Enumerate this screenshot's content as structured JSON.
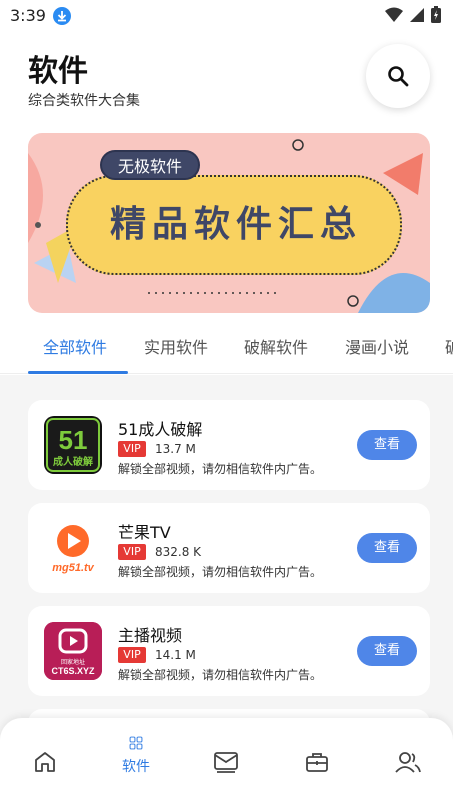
{
  "status_bar": {
    "time": "3:39"
  },
  "header": {
    "title": "软件",
    "subtitle": "综合类软件大合集"
  },
  "banner": {
    "tag": "无极软件",
    "title": "精品软件汇总"
  },
  "tabs": [
    {
      "label": "全部软件"
    },
    {
      "label": "实用软件"
    },
    {
      "label": "破解软件"
    },
    {
      "label": "漫画小说"
    },
    {
      "label": "破"
    }
  ],
  "apps": [
    {
      "name": "51成人破解",
      "badge": "VIP",
      "size": "13.7 M",
      "desc": "解锁全部视频，请勿相信软件内广告。",
      "button": "查看",
      "icon": "app-51-icon"
    },
    {
      "name": "芒果TV",
      "badge": "VIP",
      "size": "832.8 K",
      "desc": "解锁全部视频，请勿相信软件内广告。",
      "button": "查看",
      "icon": "mango-tv-icon"
    },
    {
      "name": "主播视频",
      "badge": "VIP",
      "size": "14.1 M",
      "desc": "解锁全部视频，请勿相信软件内广告。",
      "button": "查看",
      "icon": "live-video-icon"
    }
  ],
  "app_icon_text": {
    "app51_top": "51",
    "app51_bottom": "成人破解",
    "mango": "mg51.tv",
    "live_small": "回家地址",
    "live_domain": "CT6S.XYZ"
  },
  "bottom_nav": {
    "active_label": "软件"
  },
  "colors": {
    "accent": "#2f7be2",
    "vip": "#e53935",
    "button": "#4f86e8"
  }
}
